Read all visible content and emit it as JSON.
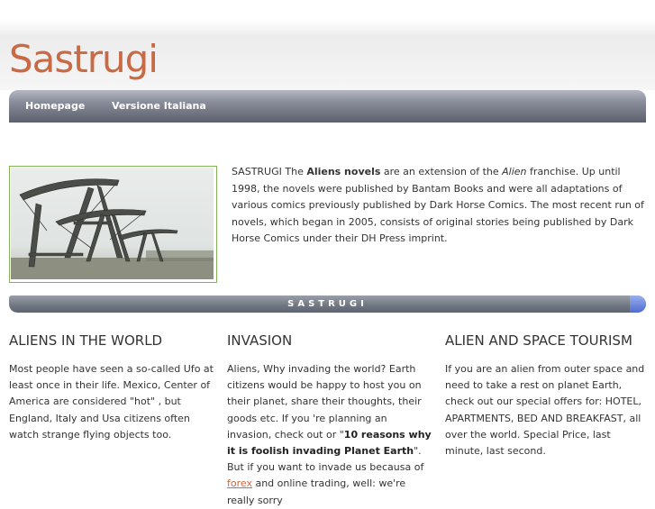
{
  "site": {
    "title": "Sastrugi"
  },
  "nav": {
    "items": [
      "Homepage",
      "Versione Italiana"
    ]
  },
  "intro": {
    "lead": "SASTRUGI The ",
    "bold": "Aliens novels",
    "mid": " are an extension of the ",
    "italic": "Alien",
    "rest": " franchise. Up until 1998, the novels were published by Bantam Books and were all adaptations of various comics previously published by Dark Horse Comics. The most recent run of novels, which began in 2005, consists of original stories being published by Dark Horse Comics under their DH Press imprint."
  },
  "bar": {
    "label": "SASTRUGI"
  },
  "columns": {
    "world": {
      "title": "ALIENS IN THE WORLD",
      "text": "Most people have seen a so-called Ufo at least once in their life. Mexico, Center of America are considered \"hot\" , but England, Italy and Usa citizens often watch strange flying objects too."
    },
    "invasion": {
      "title": "INVASION",
      "text1": "Aliens, Why invading the world? Earth citizens would be happy to host you on their planet, share their thoughts, their goods etc. If you 're planning an invasion, check out or \"",
      "bold": "10 reasons why it is foolish invading Planet Earth",
      "text2": "\". But if you want to invade us becausa of ",
      "link": "forex",
      "text3": " and online trading, well: we're really sorry"
    },
    "tourism": {
      "title": "ALIEN AND SPACE TOURISM",
      "text": "If you are an alien from outer space and need to take a rest on planet Earth, check out our special offers for: HOTEL, APARTMENTS, BED AND BREAKFAST, all over the world. Special Price, last minute, last second."
    }
  },
  "colors": {
    "accent": "#c86a45",
    "nav": "#6c707c",
    "image_border": "#86b35a"
  }
}
